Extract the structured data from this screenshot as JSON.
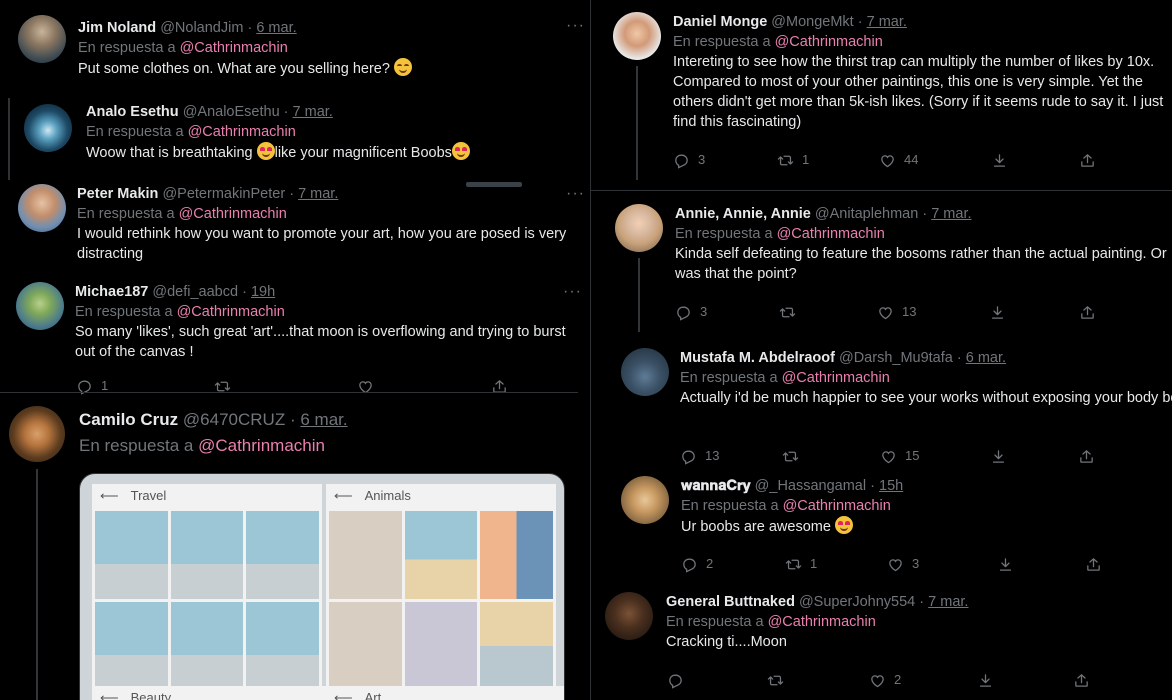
{
  "reply_prefix": "En respuesta a",
  "colors": {
    "background": "#000000",
    "text": "#e7e9ea",
    "muted": "#71767b",
    "mention": "#e980ae"
  },
  "icons": {
    "reply": "reply-icon",
    "retweet": "retweet-icon",
    "like": "heart-icon",
    "share": "share-icon",
    "download": "download-icon",
    "more": "more-icon"
  },
  "left": {
    "tweets": [
      {
        "name": "Jim Noland",
        "handle": "@NolandJim",
        "sep": "·",
        "date": "6 mar.",
        "reply_to": "@Cathrinmachin",
        "text": "Put some clothes on. What are you selling here?"
      },
      {
        "name": "Analo Esethu",
        "handle": "@AnaloEsethu",
        "sep": "·",
        "date": "7 mar.",
        "reply_to": "@Cathrinmachin",
        "text_a": "Woow that is breathtaking",
        "text_b": "like your magnificent Boobs"
      },
      {
        "name": "Peter Makin",
        "handle": "@PetermakinPeter",
        "sep": "·",
        "date": "7 mar.",
        "reply_to": "@Cathrinmachin",
        "text": "I would rethink how you want to promote your art, how you are posed is very distracting"
      },
      {
        "name": "Michae187",
        "handle": "@defi_aabcd",
        "sep": "·",
        "date": "19h",
        "reply_to": "@Cathrinmachin",
        "text": "So many 'likes', such great 'art'....that moon is overflowing and trying to burst out of the canvas !",
        "replies": "1"
      }
    ],
    "camilo": {
      "name": "Camilo Cruz",
      "handle": "@6470CRUZ",
      "sep": "·",
      "date": "6 mar.",
      "reply_to": "@Cathrinmachin"
    },
    "image": {
      "panels": [
        {
          "title": "Travel"
        },
        {
          "title": "Animals"
        },
        {
          "title": "Beauty"
        },
        {
          "title": "Art"
        }
      ]
    }
  },
  "right": {
    "tweets": [
      {
        "name": "Daniel Monge",
        "handle": "@MongeMkt",
        "sep": "·",
        "date": "7 mar.",
        "reply_to": "@Cathrinmachin",
        "text": "Intereting to see how the thirst trap can multiply the number of likes by 10x. Compared to most of your other paintings, this one is very simple. Yet the others didn't get more than 5k-ish likes. (Sorry if it seems rude to say it. I just find this fascinating)",
        "replies": "3",
        "retweets": "1",
        "likes": "44"
      },
      {
        "name": "Annie, Annie, Annie",
        "handle": "@Anitaplehman",
        "sep": "·",
        "date": "7 mar.",
        "reply_to": "@Cathrinmachin",
        "text": "Kinda self defeating to feature the bosoms rather than the actual painting. Or was that the point?",
        "replies": "3",
        "retweets": "",
        "likes": "13"
      },
      {
        "name": "Mustafa M. Abdelraoof",
        "handle": "@Darsh_Mu9tafa",
        "sep": "·",
        "date": "6 mar.",
        "reply_to": "@Cathrinmachin",
        "text": "Actually i'd be much happier to see your works without exposing your body beside. Great talent btw",
        "replies": "13",
        "retweets": "",
        "likes": "15"
      },
      {
        "name": "𝐰𝐚𝐧𝐧𝐚𝐂𝐫𝐲",
        "handle": "@_Hassangamal",
        "sep": "·",
        "date": "15h",
        "reply_to": "@Cathrinmachin",
        "text": "Ur boobs are awesome",
        "replies": "2",
        "retweets": "1",
        "likes": "3"
      },
      {
        "name": "General Buttnaked",
        "handle": "@SuperJohny554",
        "sep": "·",
        "date": "7 mar.",
        "reply_to": "@Cathrinmachin",
        "text": "Cracking ti....Moon",
        "replies": "",
        "retweets": "",
        "likes": "2"
      }
    ]
  }
}
